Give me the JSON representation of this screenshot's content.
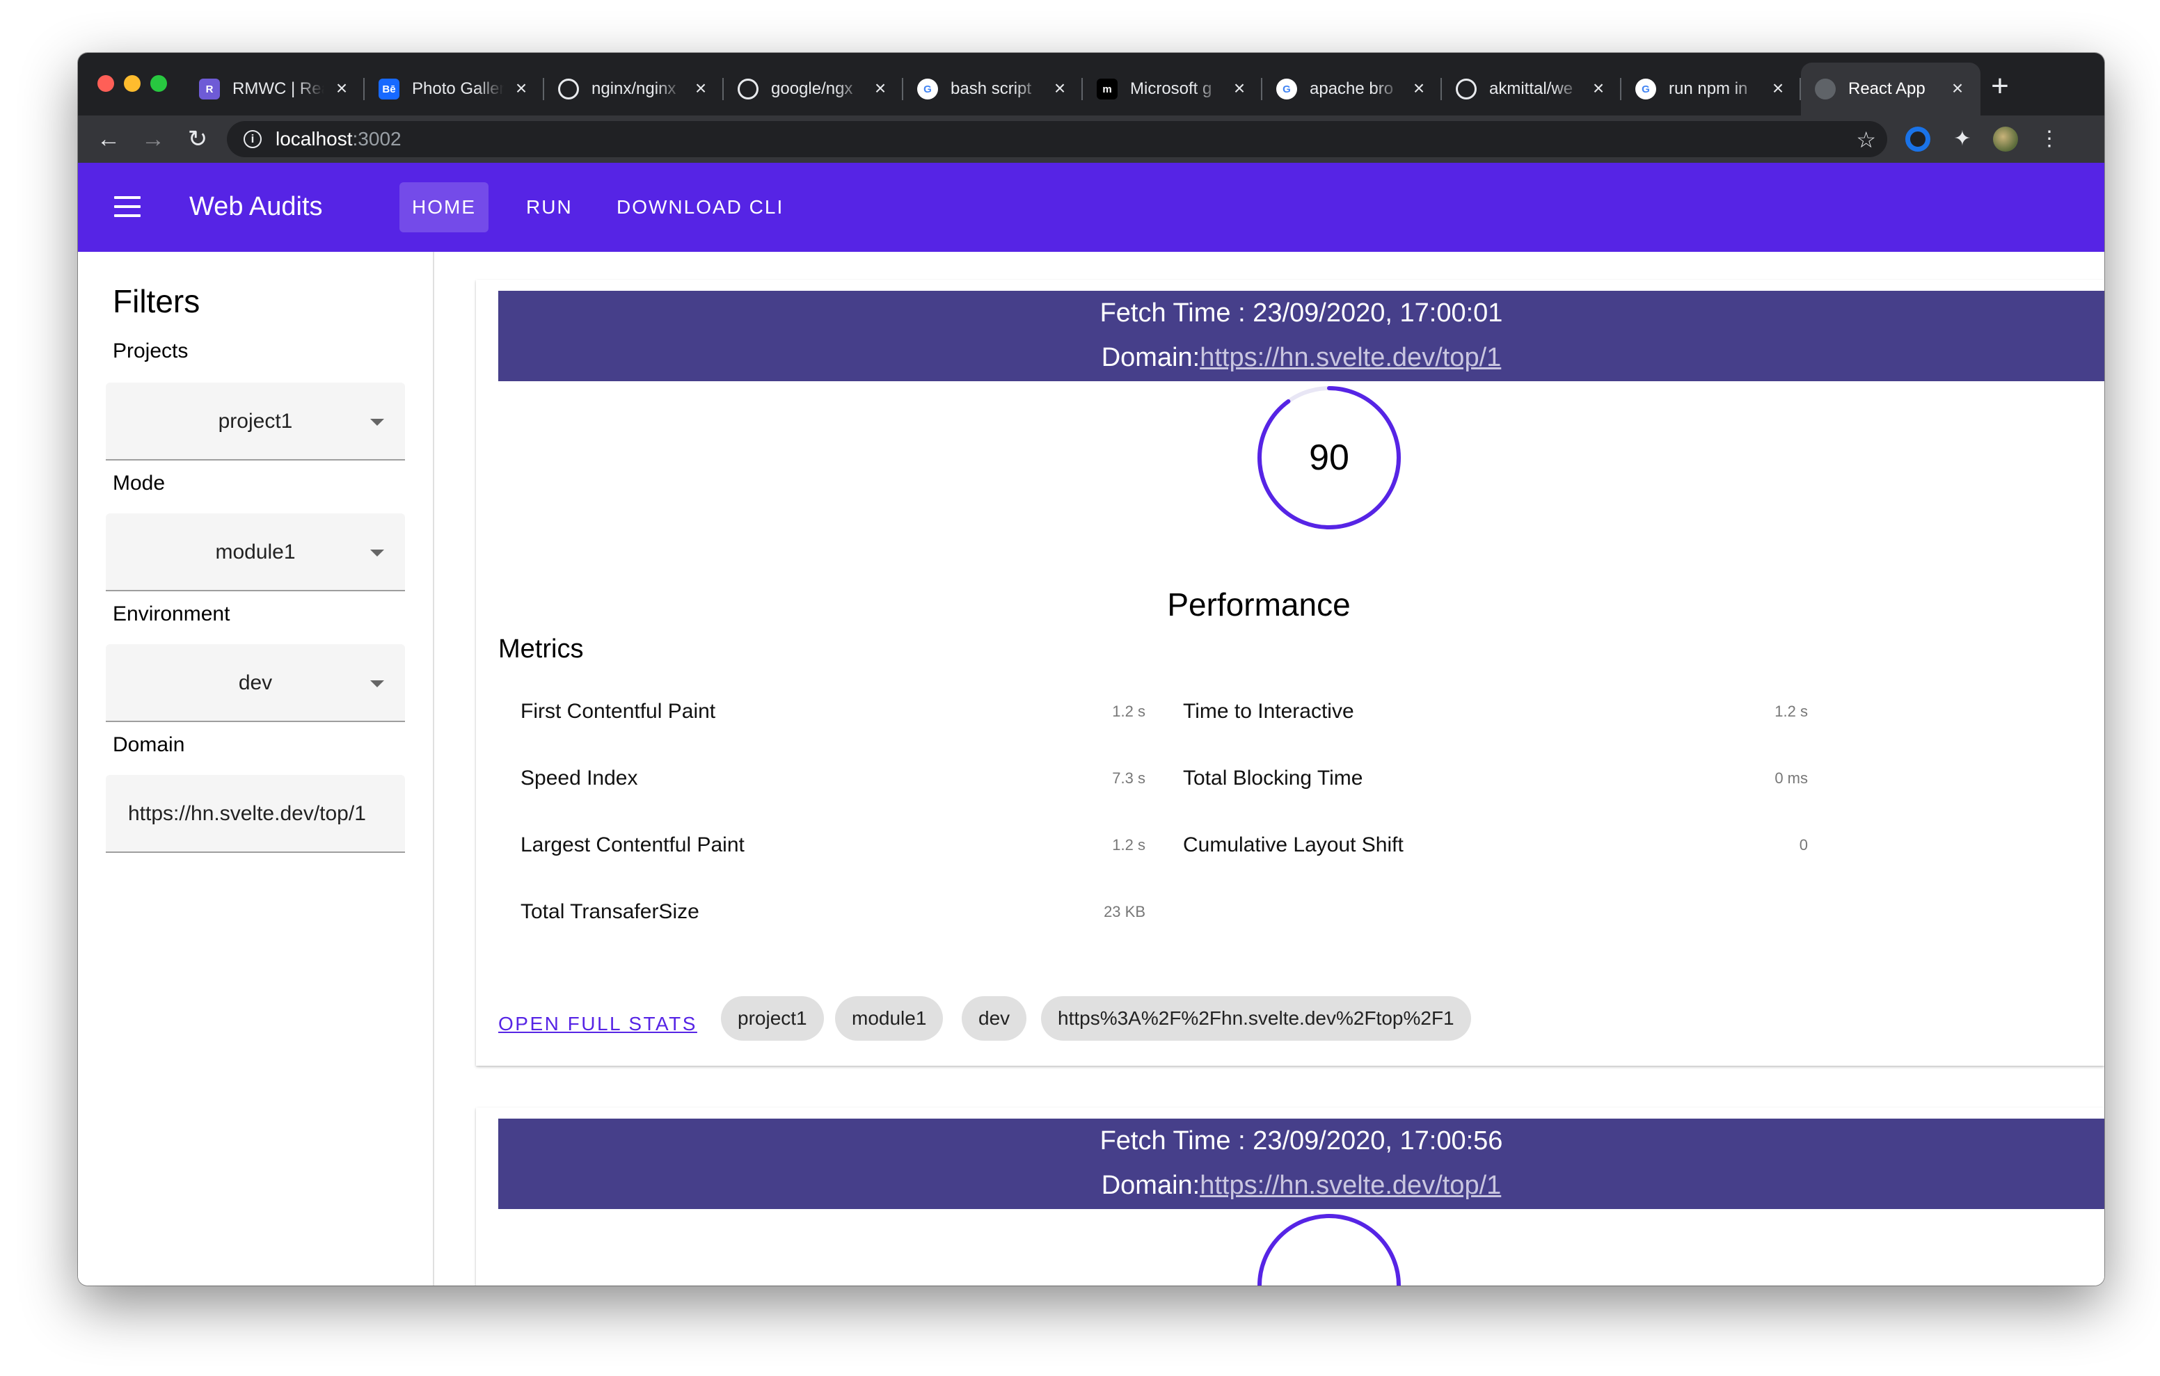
{
  "browser": {
    "tabs": [
      {
        "title": "RMWC | React",
        "favicon": "rmwc-icon",
        "favicon_color": "#6e5bd6",
        "favicon_text": "R"
      },
      {
        "title": "Photo Gallery",
        "favicon": "behance-icon",
        "favicon_color": "#1769ff",
        "favicon_text": "Bē"
      },
      {
        "title": "nginx/nginx",
        "favicon": "github-icon",
        "favicon_color": "#202124",
        "favicon_text": ""
      },
      {
        "title": "google/ngx",
        "favicon": "github-icon",
        "favicon_color": "#202124",
        "favicon_text": ""
      },
      {
        "title": "bash script",
        "favicon": "google-icon",
        "favicon_color": "#ffffff",
        "favicon_text": "G"
      },
      {
        "title": "Microsoft g",
        "favicon": "microsoft-icon",
        "favicon_color": "#000000",
        "favicon_text": "m"
      },
      {
        "title": "apache bro",
        "favicon": "google-icon",
        "favicon_color": "#ffffff",
        "favicon_text": "G"
      },
      {
        "title": "akmittal/we",
        "favicon": "github-icon",
        "favicon_color": "#202124",
        "favicon_text": ""
      },
      {
        "title": "run npm in",
        "favicon": "google-icon",
        "favicon_color": "#ffffff",
        "favicon_text": "G"
      },
      {
        "title": "React App",
        "favicon": "globe-icon",
        "favicon_color": "#5f6368",
        "favicon_text": "",
        "active": true
      }
    ],
    "url_host": "localhost",
    "url_port": ":3002"
  },
  "appbar": {
    "title": "Web Audits",
    "nav": [
      {
        "label": "HOME",
        "active": true
      },
      {
        "label": "RUN",
        "active": false
      },
      {
        "label": "DOWNLOAD CLI",
        "active": false
      }
    ],
    "color": "#5624e5"
  },
  "sidebar": {
    "title": "Filters",
    "projects_label": "Projects",
    "projects_value": "project1",
    "mode_label": "Mode",
    "mode_value": "module1",
    "environment_label": "Environment",
    "environment_value": "dev",
    "domain_label": "Domain",
    "domain_value": "https://hn.svelte.dev/top/1"
  },
  "reports": [
    {
      "fetch_time": "Fetch Time : 23/09/2020, 17:00:01",
      "domain_prefix": "Domain:",
      "domain_url": "https://hn.svelte.dev/top/1",
      "score": 90,
      "category": "Performance",
      "metrics_title": "Metrics",
      "metrics": [
        {
          "name": "First Contentful Paint",
          "value": "1.2 s"
        },
        {
          "name": "Speed Index",
          "value": "7.3 s"
        },
        {
          "name": "Largest Contentful Paint",
          "value": "1.2 s"
        },
        {
          "name": "Total TransaferSize",
          "value": "23 KB"
        },
        {
          "name": "Time to Interactive",
          "value": "1.2 s"
        },
        {
          "name": "Total Blocking Time",
          "value": "0 ms"
        },
        {
          "name": "Cumulative Layout Shift",
          "value": "0"
        }
      ],
      "open_full_stats": "OPEN FULL STATS",
      "chips": [
        "project1",
        "module1",
        "dev",
        "https%3A%2F%2Fhn.svelte.dev%2Ftop%2F1"
      ]
    },
    {
      "fetch_time": "Fetch Time : 23/09/2020, 17:00:56",
      "domain_prefix": "Domain:",
      "domain_url": "https://hn.svelte.dev/top/1"
    }
  ]
}
